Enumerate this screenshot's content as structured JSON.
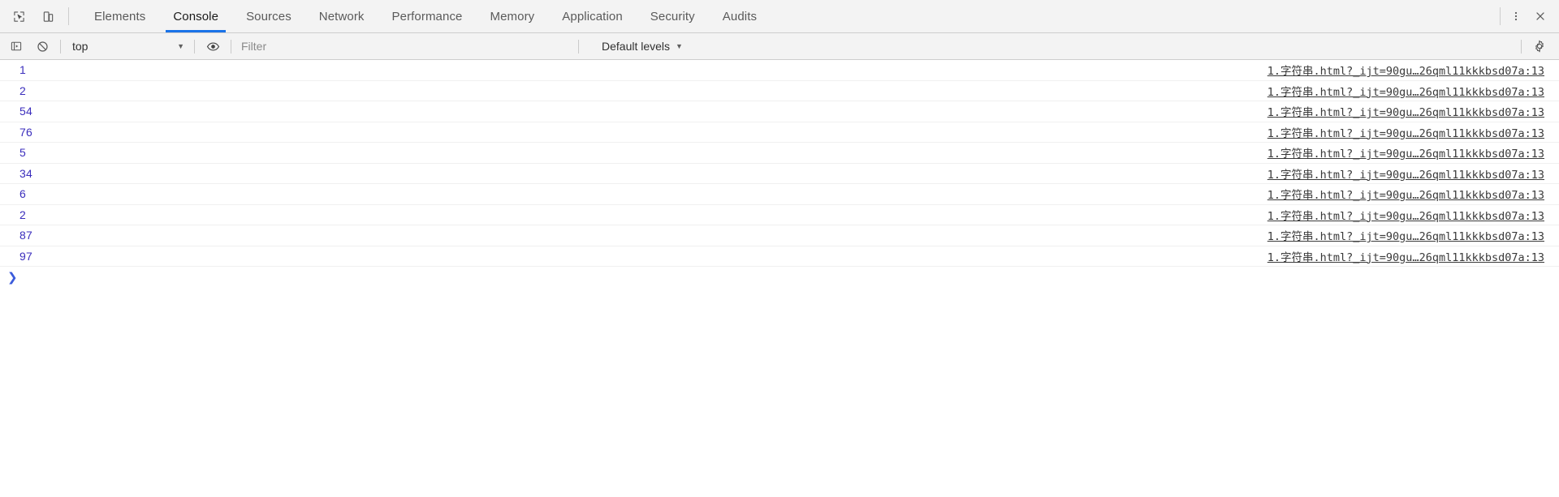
{
  "window": {
    "title": "Chrome DevTools"
  },
  "tabbar": {
    "inspect_icon": "inspect-element-icon",
    "device_icon": "device-toolbar-icon",
    "tabs": [
      {
        "label": "Elements",
        "active": false
      },
      {
        "label": "Console",
        "active": true
      },
      {
        "label": "Sources",
        "active": false
      },
      {
        "label": "Network",
        "active": false
      },
      {
        "label": "Performance",
        "active": false
      },
      {
        "label": "Memory",
        "active": false
      },
      {
        "label": "Application",
        "active": false
      },
      {
        "label": "Security",
        "active": false
      },
      {
        "label": "Audits",
        "active": false
      }
    ],
    "more_icon": "three-dots-vertical-icon",
    "close_icon": "close-icon",
    "active_underline_color": "#1a73e8"
  },
  "console_toolbar": {
    "sidebar_toggle_icon": "console-sidebar-toggle-icon",
    "clear_icon": "clear-console-icon",
    "context": {
      "value": "top",
      "caret": "▼"
    },
    "eye_icon": "live-expression-eye-icon",
    "filter": {
      "value": "",
      "placeholder": "Filter"
    },
    "levels": {
      "value": "Default levels",
      "caret": "▼"
    },
    "settings_icon": "settings-gear-icon"
  },
  "console": {
    "link_text": "1.字符串.html?_ijt=90gu…26qml11kkkbsd07a:13",
    "messages": [
      {
        "value": "1"
      },
      {
        "value": "2"
      },
      {
        "value": "54"
      },
      {
        "value": "76"
      },
      {
        "value": "5"
      },
      {
        "value": "34"
      },
      {
        "value": "6"
      },
      {
        "value": "2"
      },
      {
        "value": "87"
      },
      {
        "value": "97"
      }
    ],
    "prompt": {
      "chevron": "❯",
      "value": "",
      "placeholder": ""
    },
    "value_color": "#3b2ebd"
  }
}
